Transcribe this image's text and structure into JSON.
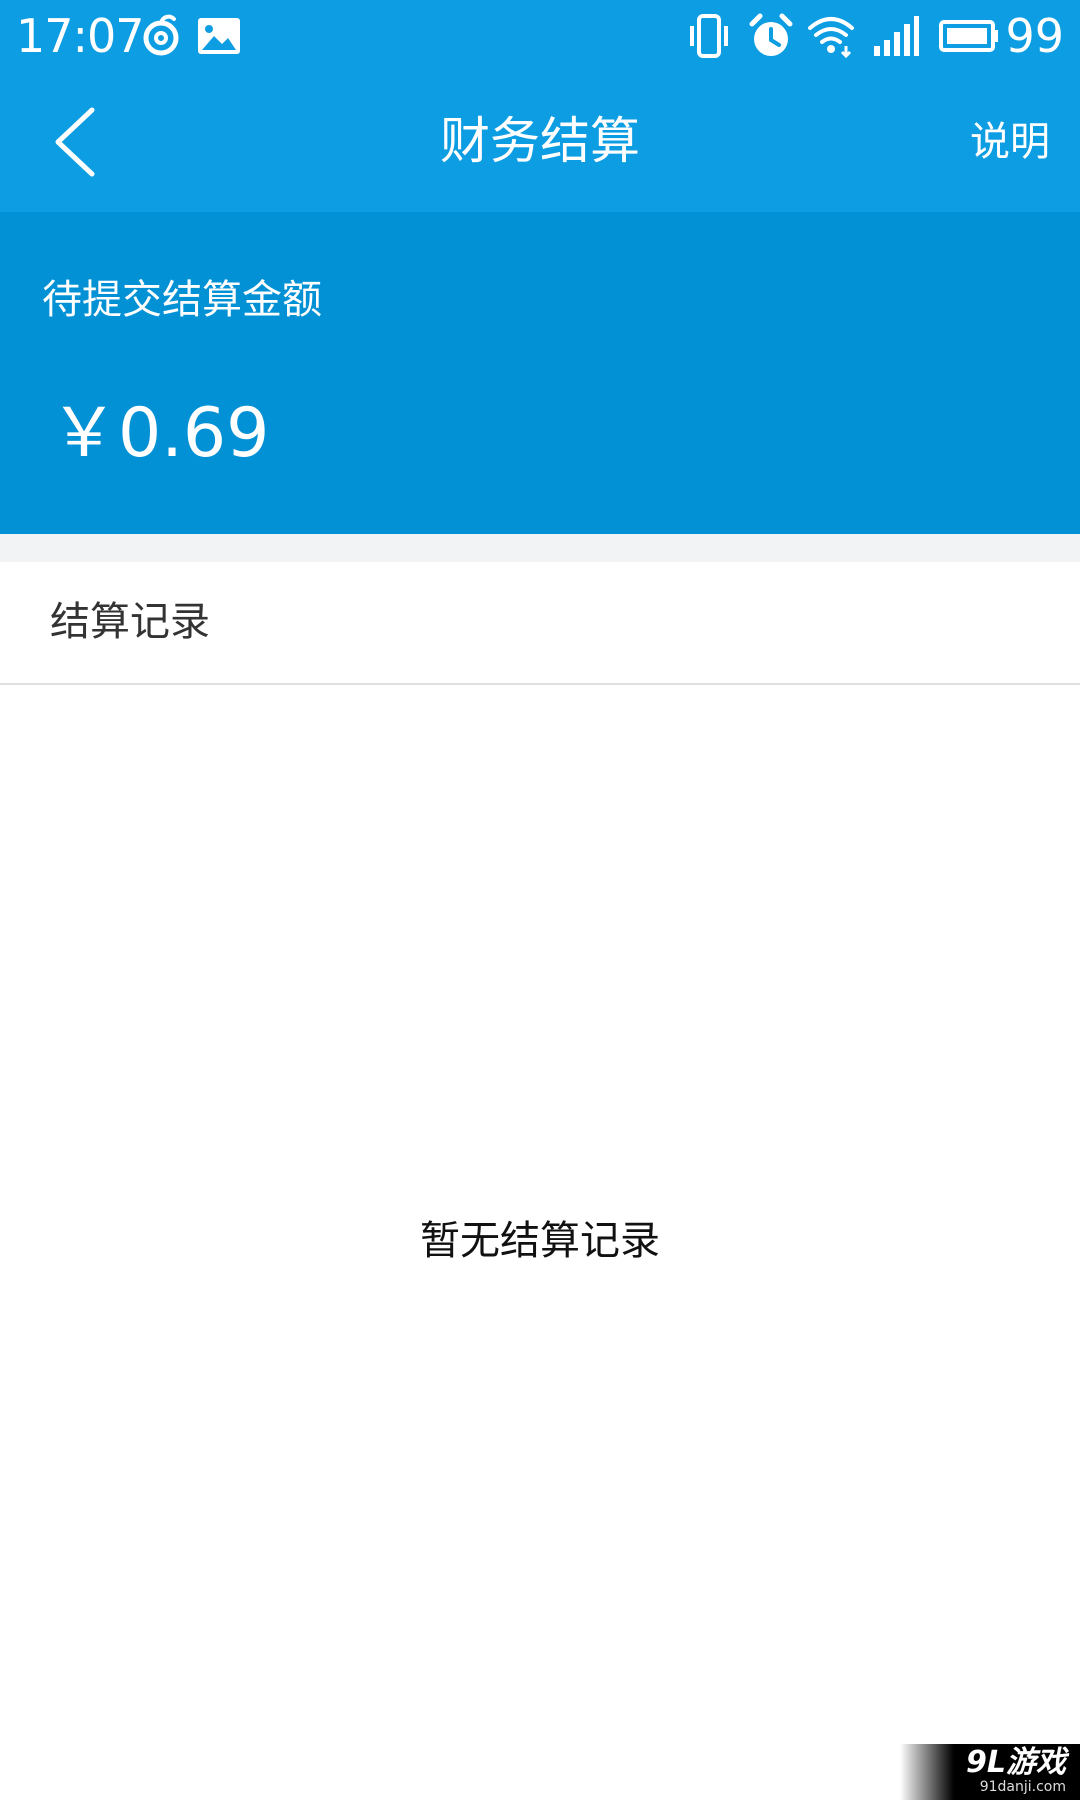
{
  "status_bar": {
    "time": "17:07",
    "battery": "99",
    "icons": [
      "netease-music-icon",
      "gallery-icon",
      "vibrate-icon",
      "alarm-icon",
      "wifi-icon",
      "signal-icon",
      "battery-icon"
    ]
  },
  "header": {
    "title": "财务结算",
    "help_label": "说明",
    "back_icon": "chevron-left-icon"
  },
  "summary": {
    "label": "待提交结算金额",
    "amount": "￥0.69"
  },
  "records": {
    "title": "结算记录",
    "empty_text": "暂无结算记录"
  },
  "watermark": {
    "logo": "9L游戏",
    "url": "91danji.com"
  },
  "colors": {
    "header_bg": "#0d9de3",
    "panel_bg": "#0291d5",
    "divider": "#e0e0e0",
    "gap_bg": "#f2f3f4"
  }
}
